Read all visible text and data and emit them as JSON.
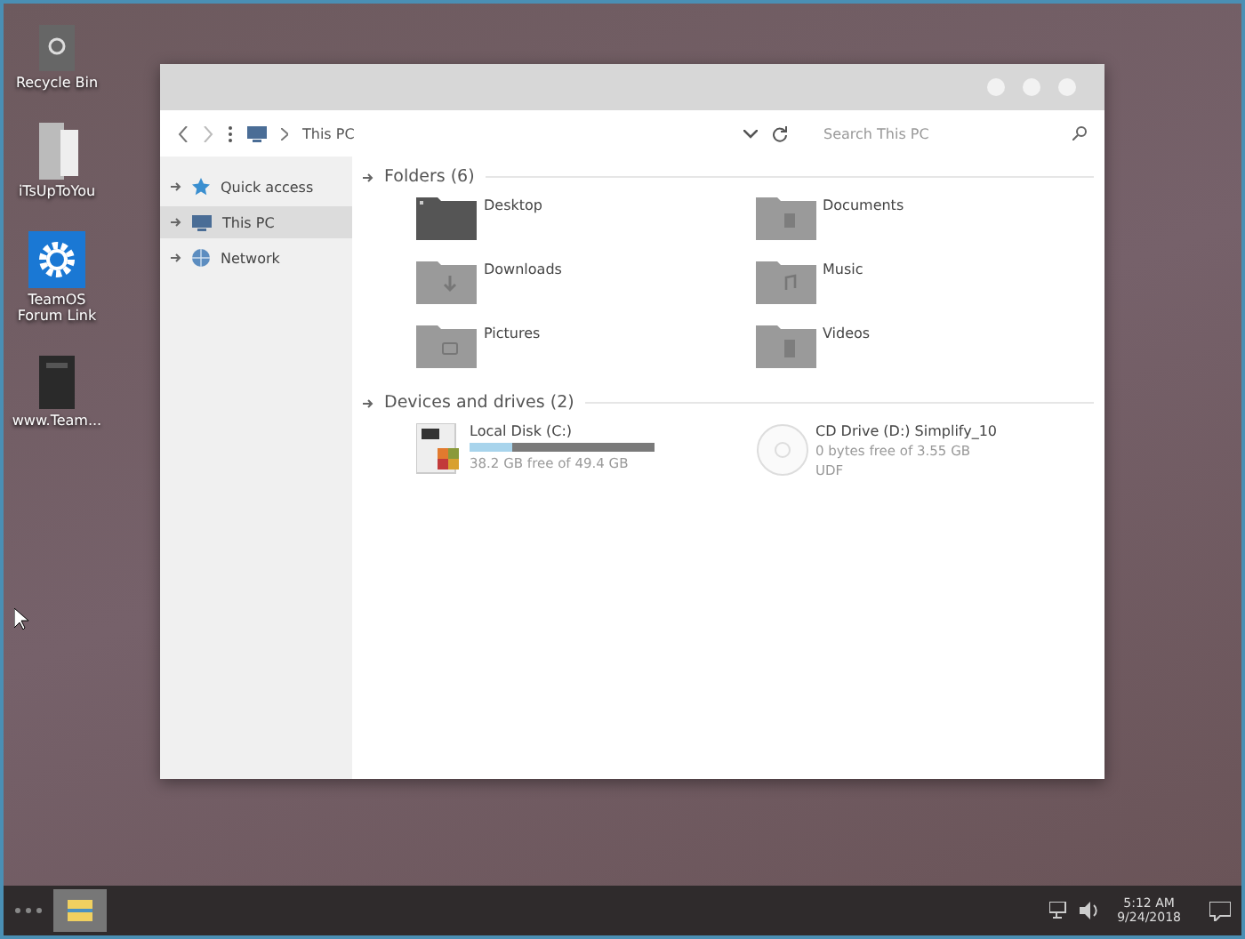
{
  "desktop_icons": [
    {
      "kind": "recycle",
      "label": "Recycle Bin"
    },
    {
      "kind": "file",
      "label": "iTsUpToYou"
    },
    {
      "kind": "gear",
      "label": "TeamOS Forum Link"
    },
    {
      "kind": "doc",
      "label": "www.Team..."
    }
  ],
  "window": {
    "breadcrumb": "This PC",
    "search": {
      "placeholder": "Search This PC"
    }
  },
  "sidebar": {
    "items": [
      {
        "kind": "star",
        "label": "Quick access",
        "selected": false
      },
      {
        "kind": "pc",
        "label": "This PC",
        "selected": true
      },
      {
        "kind": "globe",
        "label": "Network",
        "selected": false
      }
    ]
  },
  "folders": {
    "title": "Folders (6)",
    "items": [
      {
        "kind": "desktop",
        "label": "Desktop"
      },
      {
        "kind": "documents",
        "label": "Documents"
      },
      {
        "kind": "downloads",
        "label": "Downloads"
      },
      {
        "kind": "music",
        "label": "Music"
      },
      {
        "kind": "pictures",
        "label": "Pictures"
      },
      {
        "kind": "videos",
        "label": "Videos"
      }
    ]
  },
  "drives": {
    "title": "Devices and drives (2)",
    "items": [
      {
        "kind": "disk",
        "name": "Local Disk (C:)",
        "level": 0.23,
        "free": "38.2 GB free of 49.4 GB"
      },
      {
        "kind": "cd",
        "name": "CD Drive (D:) Simplify_10",
        "free": "0 bytes free of 3.55 GB",
        "filesystem": "UDF"
      }
    ]
  },
  "taskbar": {
    "time": "5:12 AM",
    "date": "9/24/2018"
  }
}
